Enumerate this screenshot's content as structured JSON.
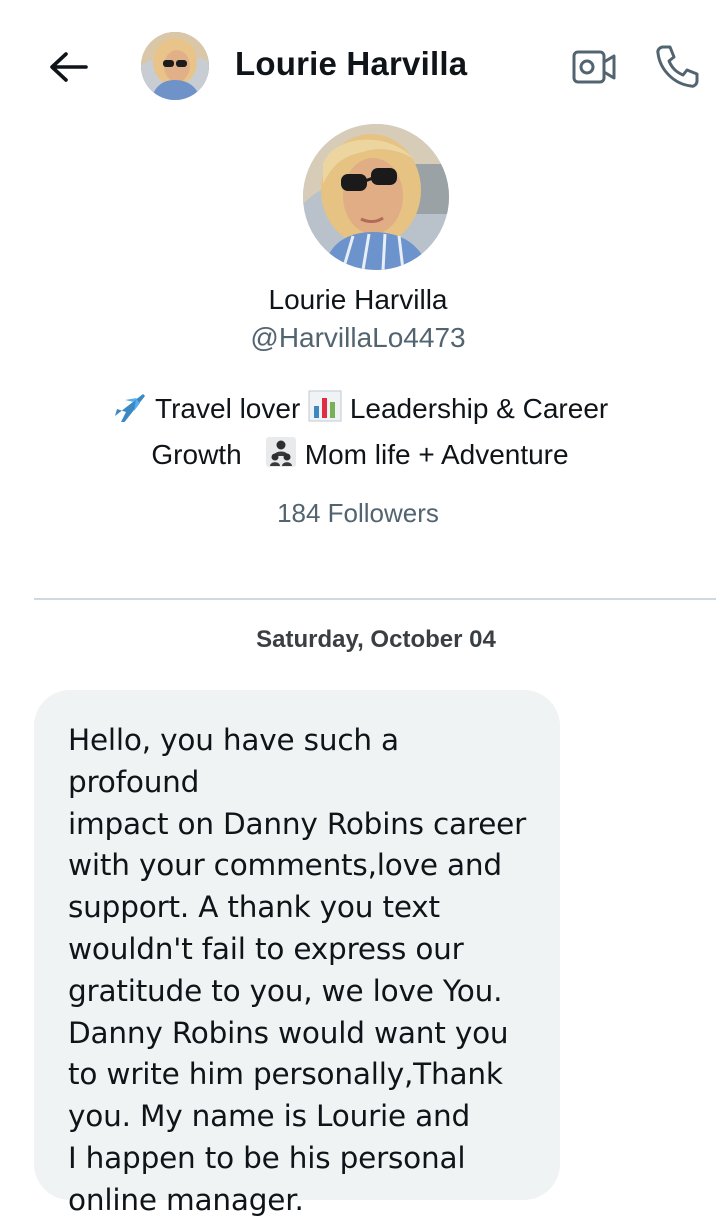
{
  "header": {
    "name": "Lourie Harvilla"
  },
  "profile": {
    "name": "Lourie Harvilla",
    "handle": "@HarvillaLo4473",
    "bio_line1_a": "Travel lover",
    "bio_line1_b": "Leadership & Career",
    "bio_line2_a": "Growth",
    "bio_line2_b": "Mom life + Adventure",
    "followers": "184 Followers"
  },
  "icons": {
    "back": "arrow-left-icon",
    "video": "video-camera-icon",
    "call": "phone-icon",
    "airplane": "airplane-emoji",
    "chart": "bar-chart-emoji",
    "family": "family-emoji"
  },
  "conversation": {
    "date": "Saturday, October 04",
    "message": "Hello, you have such a profound\nimpact on Danny Robins career\nwith your comments,love and\nsupport. A thank you text\nwouldn't fail to express our\ngratitude to you, we love You.\nDanny Robins would want you\nto write him personally,Thank\nyou. My name is Lourie and\nI happen to be his personal\nonline manager."
  },
  "colors": {
    "bubble": "#eff3f4",
    "secondary_text": "#536471",
    "divider": "#cfd9de"
  }
}
